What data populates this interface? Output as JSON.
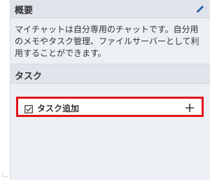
{
  "overview": {
    "title": "概要",
    "description": "マイチャットは自分専用のチャットです。自分用のメモやタスク管理、ファイルサーバーとして利用することができます。",
    "edit_icon": "pencil-icon"
  },
  "tasks": {
    "title": "タスク",
    "add_label": "タスク追加",
    "checkbox_icon": "checkbox-icon",
    "add_icon": "plus-icon",
    "highlight_color": "#e3151b"
  }
}
